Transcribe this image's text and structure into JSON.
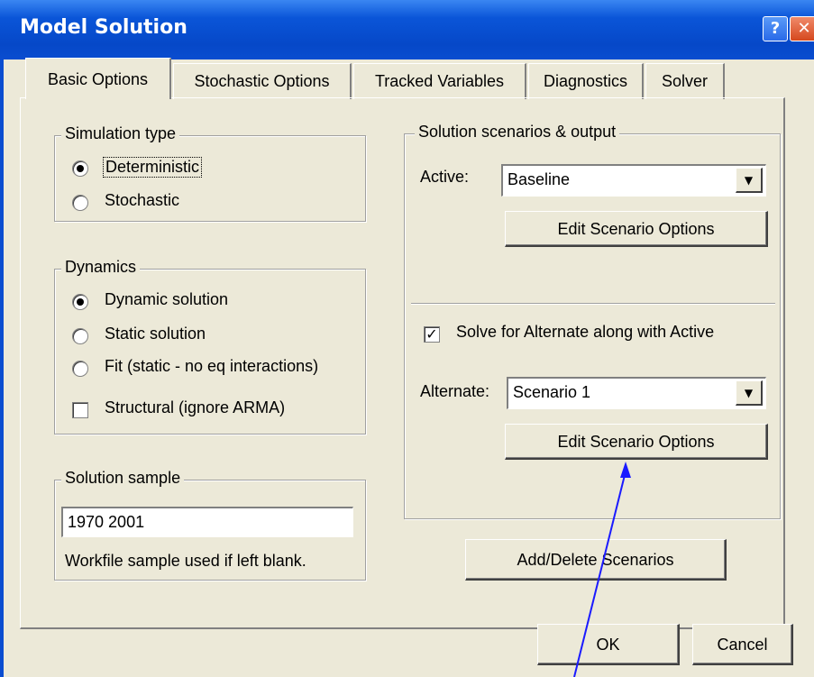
{
  "window": {
    "title": "Model Solution",
    "help_glyph": "?",
    "close_glyph": "✕"
  },
  "tabs": [
    {
      "label": "Basic Options",
      "active": true
    },
    {
      "label": "Stochastic Options",
      "active": false
    },
    {
      "label": "Tracked Variables",
      "active": false
    },
    {
      "label": "Diagnostics",
      "active": false
    },
    {
      "label": "Solver",
      "active": false
    }
  ],
  "simulation_type": {
    "label": "Simulation type",
    "options": [
      {
        "label": "Deterministic",
        "checked": true
      },
      {
        "label": "Stochastic",
        "checked": false
      }
    ]
  },
  "dynamics": {
    "label": "Dynamics",
    "options": [
      {
        "label": "Dynamic solution",
        "checked": true
      },
      {
        "label": "Static solution",
        "checked": false
      },
      {
        "label": "Fit (static - no eq interactions)",
        "checked": false
      }
    ],
    "structural": {
      "label": "Structural (ignore ARMA)",
      "checked": false
    }
  },
  "solution_sample": {
    "label": "Solution sample",
    "value": "1970 2001",
    "hint": "Workfile sample used if left blank."
  },
  "scenarios": {
    "label": "Solution scenarios & output",
    "active_label": "Active:",
    "active_value": "Baseline",
    "edit_active_button": "Edit Scenario Options",
    "solve_alternate": {
      "label": "Solve for Alternate along with Active",
      "checked": true
    },
    "alternate_label": "Alternate:",
    "alternate_value": "Scenario 1",
    "edit_alternate_button": "Edit Scenario Options"
  },
  "add_delete_button": "Add/Delete Scenarios",
  "footer": {
    "ok": "OK",
    "cancel": "Cancel"
  },
  "annotation": {
    "color": "#1a1aff"
  },
  "icons": {
    "combo_arrow": "▼",
    "check_mark": "✓"
  }
}
